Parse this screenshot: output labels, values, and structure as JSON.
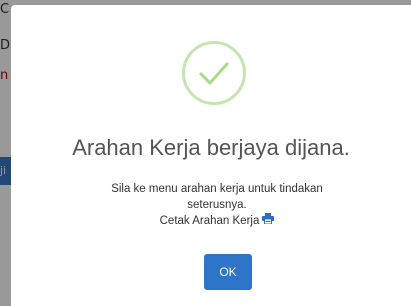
{
  "background": {
    "line1": "C",
    "line2": "D",
    "line3": "n",
    "bar_text": "ji"
  },
  "modal": {
    "icon": "check-circle-icon",
    "title": "Arahan Kerja berjaya dijana.",
    "message_line1": "Sila ke menu arahan kerja untuk tindakan",
    "message_line2": "seterusnya.",
    "print_label": "Cetak Arahan Kerja",
    "print_icon": "printer-icon",
    "ok_label": "OK"
  },
  "colors": {
    "check": "#a5dc86",
    "ok_button": "#2e75c9",
    "link": "#2b6cc4"
  }
}
